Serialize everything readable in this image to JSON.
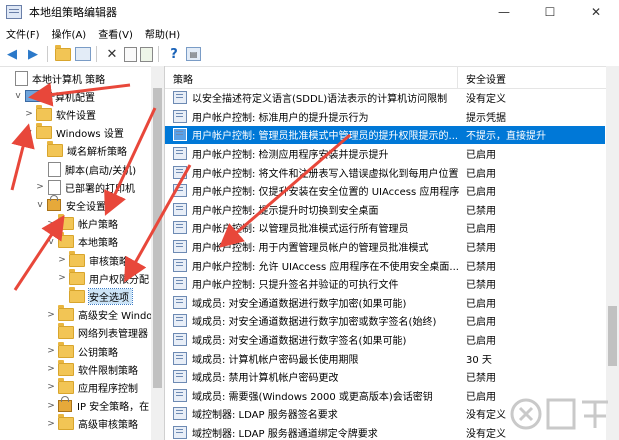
{
  "window": {
    "title": "本地组策略编辑器",
    "minimize": "—",
    "maximize": "☐",
    "close": "✕"
  },
  "menu": [
    "文件(F)",
    "操作(A)",
    "查看(V)",
    "帮助(H)"
  ],
  "toolbar_icons": [
    "back-arrow",
    "forward-arrow",
    "folder-up",
    "console-tree",
    "delete",
    "properties",
    "export",
    "help",
    "filter"
  ],
  "tree": [
    {
      "label": "本地计算机 策略",
      "indent": 0,
      "expander": "",
      "icon": "doc"
    },
    {
      "label": "计算机配置",
      "indent": 1,
      "expander": "v",
      "icon": "pc"
    },
    {
      "label": "软件设置",
      "indent": 2,
      "expander": ">",
      "icon": "folder"
    },
    {
      "label": "Windows 设置",
      "indent": 2,
      "expander": "v",
      "icon": "folder"
    },
    {
      "label": "域名解析策略",
      "indent": 3,
      "expander": "",
      "icon": "folder"
    },
    {
      "label": "脚本(启动/关机)",
      "indent": 3,
      "expander": "",
      "icon": "doc"
    },
    {
      "label": "已部署的打印机",
      "indent": 3,
      "expander": ">",
      "icon": "doc"
    },
    {
      "label": "安全设置",
      "indent": 3,
      "expander": "v",
      "icon": "lock"
    },
    {
      "label": "帐户策略",
      "indent": 4,
      "expander": ">",
      "icon": "folder"
    },
    {
      "label": "本地策略",
      "indent": 4,
      "expander": "v",
      "icon": "folder"
    },
    {
      "label": "审核策略",
      "indent": 5,
      "expander": ">",
      "icon": "folder"
    },
    {
      "label": "用户权限分配",
      "indent": 5,
      "expander": ">",
      "icon": "folder"
    },
    {
      "label": "安全选项",
      "indent": 5,
      "expander": "",
      "icon": "folder",
      "selected": true
    },
    {
      "label": "高级安全 Windows",
      "indent": 4,
      "expander": ">",
      "icon": "folder"
    },
    {
      "label": "网络列表管理器",
      "indent": 4,
      "expander": "",
      "icon": "folder"
    },
    {
      "label": "公钥策略",
      "indent": 4,
      "expander": ">",
      "icon": "folder"
    },
    {
      "label": "软件限制策略",
      "indent": 4,
      "expander": ">",
      "icon": "folder"
    },
    {
      "label": "应用程序控制",
      "indent": 4,
      "expander": ">",
      "icon": "folder"
    },
    {
      "label": "IP 安全策略，在",
      "indent": 4,
      "expander": ">",
      "icon": "lock"
    },
    {
      "label": "高级审核策略",
      "indent": 4,
      "expander": ">",
      "icon": "folder"
    }
  ],
  "list": {
    "col_policy": "策略",
    "col_setting": "安全设置",
    "rows": [
      {
        "name": "以安全描述符定义语言(SDDL)语法表示的计算机访问限制",
        "value": "没有定义"
      },
      {
        "name": "用户帐户控制: 标准用户的提升提示行为",
        "value": "提示凭据"
      },
      {
        "name": "用户帐户控制: 管理员批准模式中管理员的提升权限提示的...",
        "value": "不提示，直接提升",
        "selected": true
      },
      {
        "name": "用户帐户控制: 检测应用程序安装并提示提升",
        "value": "已启用"
      },
      {
        "name": "用户帐户控制: 将文件和注册表写入错误虚拟化到每用户位置",
        "value": "已启用"
      },
      {
        "name": "用户帐户控制: 仅提升安装在安全位置的 UIAccess 应用程序",
        "value": "已启用"
      },
      {
        "name": "用户帐户控制: 提示提升时切换到安全桌面",
        "value": "已禁用"
      },
      {
        "name": "用户帐户控制: 以管理员批准模式运行所有管理员",
        "value": "已启用"
      },
      {
        "name": "用户帐户控制: 用于内置管理员帐户的管理员批准模式",
        "value": "已禁用"
      },
      {
        "name": "用户帐户控制: 允许 UIAccess 应用程序在不使用安全桌面...",
        "value": "已禁用"
      },
      {
        "name": "用户帐户控制: 只提升签名并验证的可执行文件",
        "value": "已禁用"
      },
      {
        "name": "域成员: 对安全通道数据进行数字加密(如果可能)",
        "value": "已启用"
      },
      {
        "name": "域成员: 对安全通道数据进行数字加密或数字签名(始终)",
        "value": "已启用"
      },
      {
        "name": "域成员: 对安全通道数据进行数字签名(如果可能)",
        "value": "已启用"
      },
      {
        "name": "域成员: 计算机帐户密码最长使用期限",
        "value": "30 天"
      },
      {
        "name": "域成员: 禁用计算机帐户密码更改",
        "value": "已禁用"
      },
      {
        "name": "域成员: 需要强(Windows 2000 或更高版本)会话密钥",
        "value": "已启用"
      },
      {
        "name": "域控制器: LDAP 服务器签名要求",
        "value": "没有定义"
      },
      {
        "name": "域控制器: LDAP 服务器通道绑定令牌要求",
        "value": "没有定义"
      }
    ]
  },
  "colors": {
    "selection": "#0078d7",
    "tree_selection": "#cce4f7",
    "arrow": "#e8473a"
  }
}
